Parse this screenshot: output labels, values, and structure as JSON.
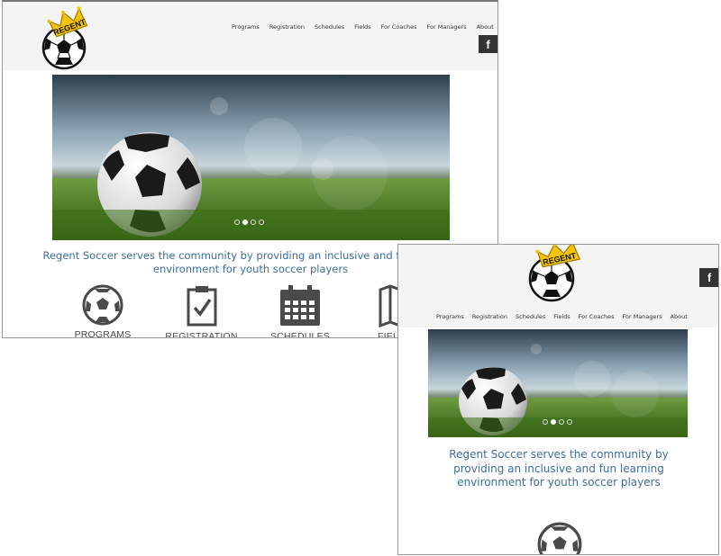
{
  "desktop": {
    "nav": [
      "Programs",
      "Registration",
      "Schedules",
      "Fields",
      "For Coaches",
      "For Managers",
      "About"
    ],
    "facebook_label": "f",
    "slider": {
      "total": 4,
      "active_index": 1
    },
    "tagline": "Regent Soccer serves the community by providing an inclusive and fun learning environment for youth soccer players",
    "features": [
      {
        "label": "PROGRAMS",
        "icon": "soccer-ball-icon"
      },
      {
        "label": "REGISTRATION",
        "icon": "clipboard-check-icon"
      },
      {
        "label": "SCHEDULES",
        "icon": "calendar-icon"
      },
      {
        "label": "FIELDS",
        "icon": "map-icon"
      }
    ]
  },
  "mobile": {
    "nav": [
      "Programs",
      "Registration",
      "Schedules",
      "Fields",
      "For Coaches",
      "For Managers",
      "About"
    ],
    "facebook_label": "f",
    "slider": {
      "total": 4,
      "active_index": 1
    },
    "tagline": "Regent Soccer serves the community by providing an inclusive and fun learning environment for youth soccer players",
    "features": [
      {
        "label": "",
        "icon": "soccer-ball-icon"
      }
    ]
  },
  "logo_text": "REGENT",
  "colors": {
    "accent_blue": "#3d6e9e",
    "header_bg": "#f4f4f4",
    "crown_gold": "#f5c400",
    "icon_gray": "#4a4a4a",
    "facebook_bg": "#333333"
  }
}
